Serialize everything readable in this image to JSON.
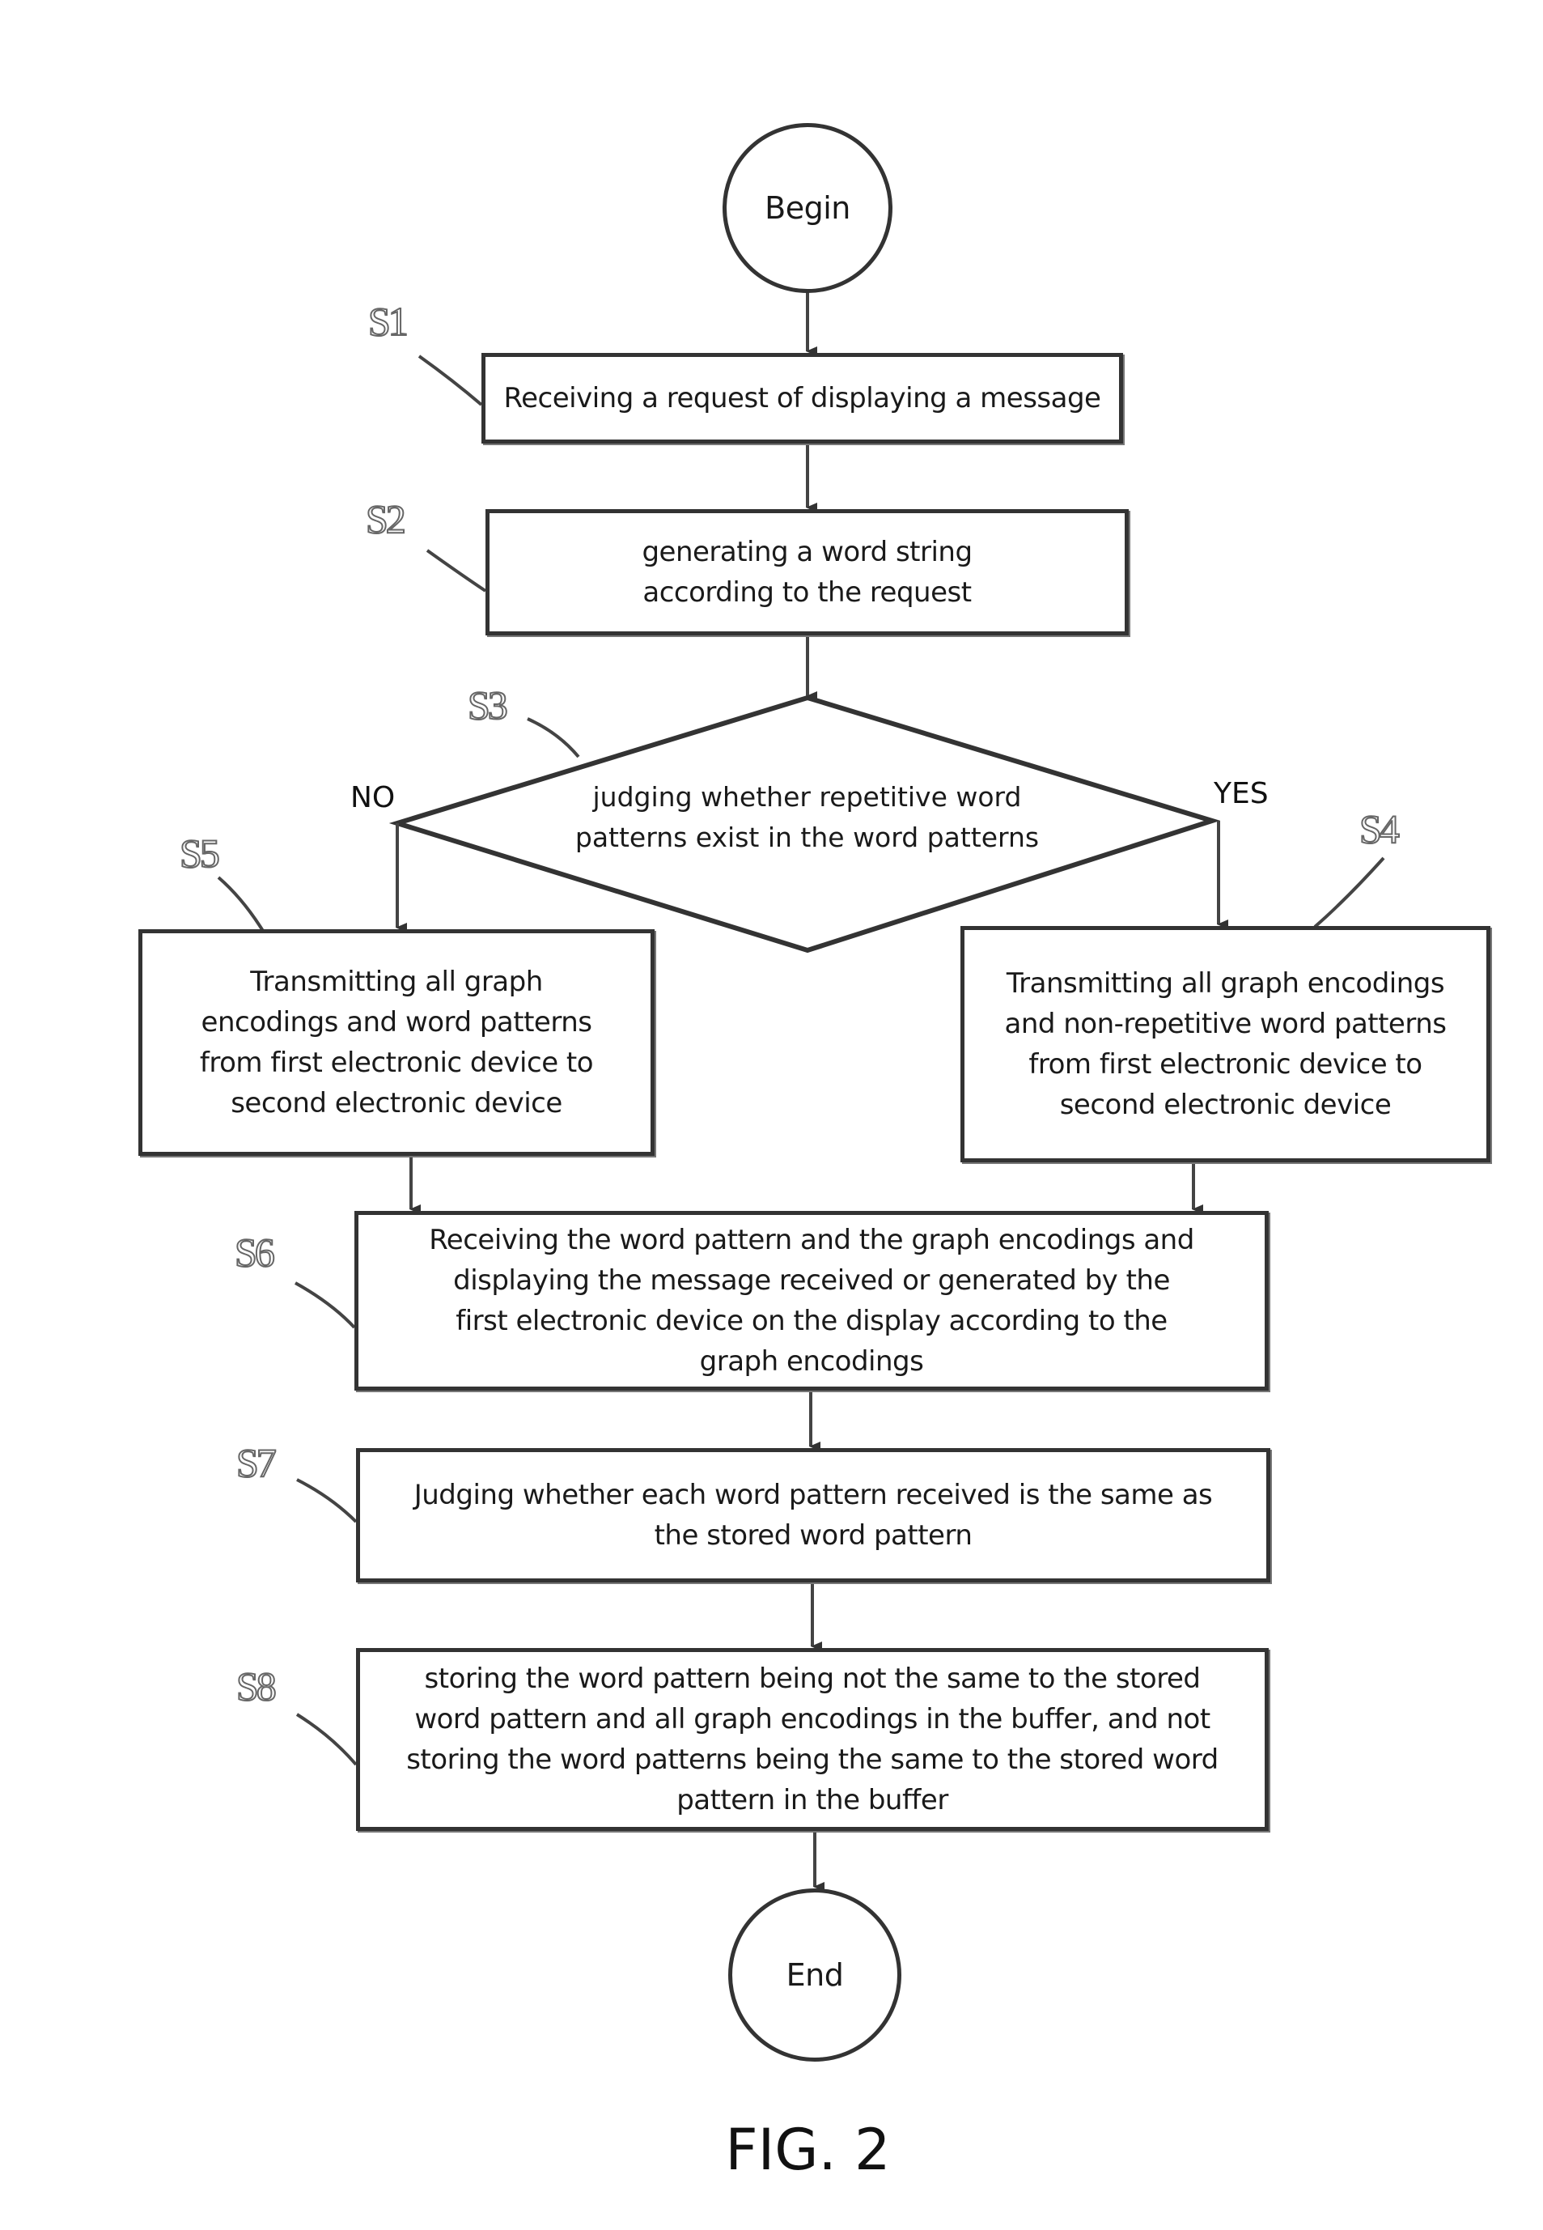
{
  "diagram": {
    "begin": "Begin",
    "end": "End",
    "figure_caption": "FIG. 2",
    "steps": {
      "s1": {
        "label": "S1",
        "text": "Receiving a request of displaying a message"
      },
      "s2": {
        "label": "S2",
        "text": "generating a word string according to the request"
      },
      "s3": {
        "label": "S3",
        "text": "judging whether repetitive word patterns exist in the word patterns"
      },
      "s4": {
        "label": "S4",
        "text": "Transmitting all graph encodings and non-repetitive word patterns from first electronic device to second electronic device"
      },
      "s5": {
        "label": "S5",
        "text": "Transmitting all graph encodings and word patterns from first electronic device to second electronic device"
      },
      "s6": {
        "label": "S6",
        "text": "Receiving the word pattern and the graph encodings and displaying the message received or generated by the first electronic device on the display according to the graph encodings"
      },
      "s7": {
        "label": "S7",
        "text": "Judging whether each word pattern received is the same as the stored word pattern"
      },
      "s8": {
        "label": "S8",
        "text": "storing the word pattern being not the same to the stored word pattern and all graph encodings in the buffer, and not storing the word patterns being the same to the stored word pattern in the buffer"
      }
    },
    "branches": {
      "no": "NO",
      "yes": "YES"
    }
  }
}
